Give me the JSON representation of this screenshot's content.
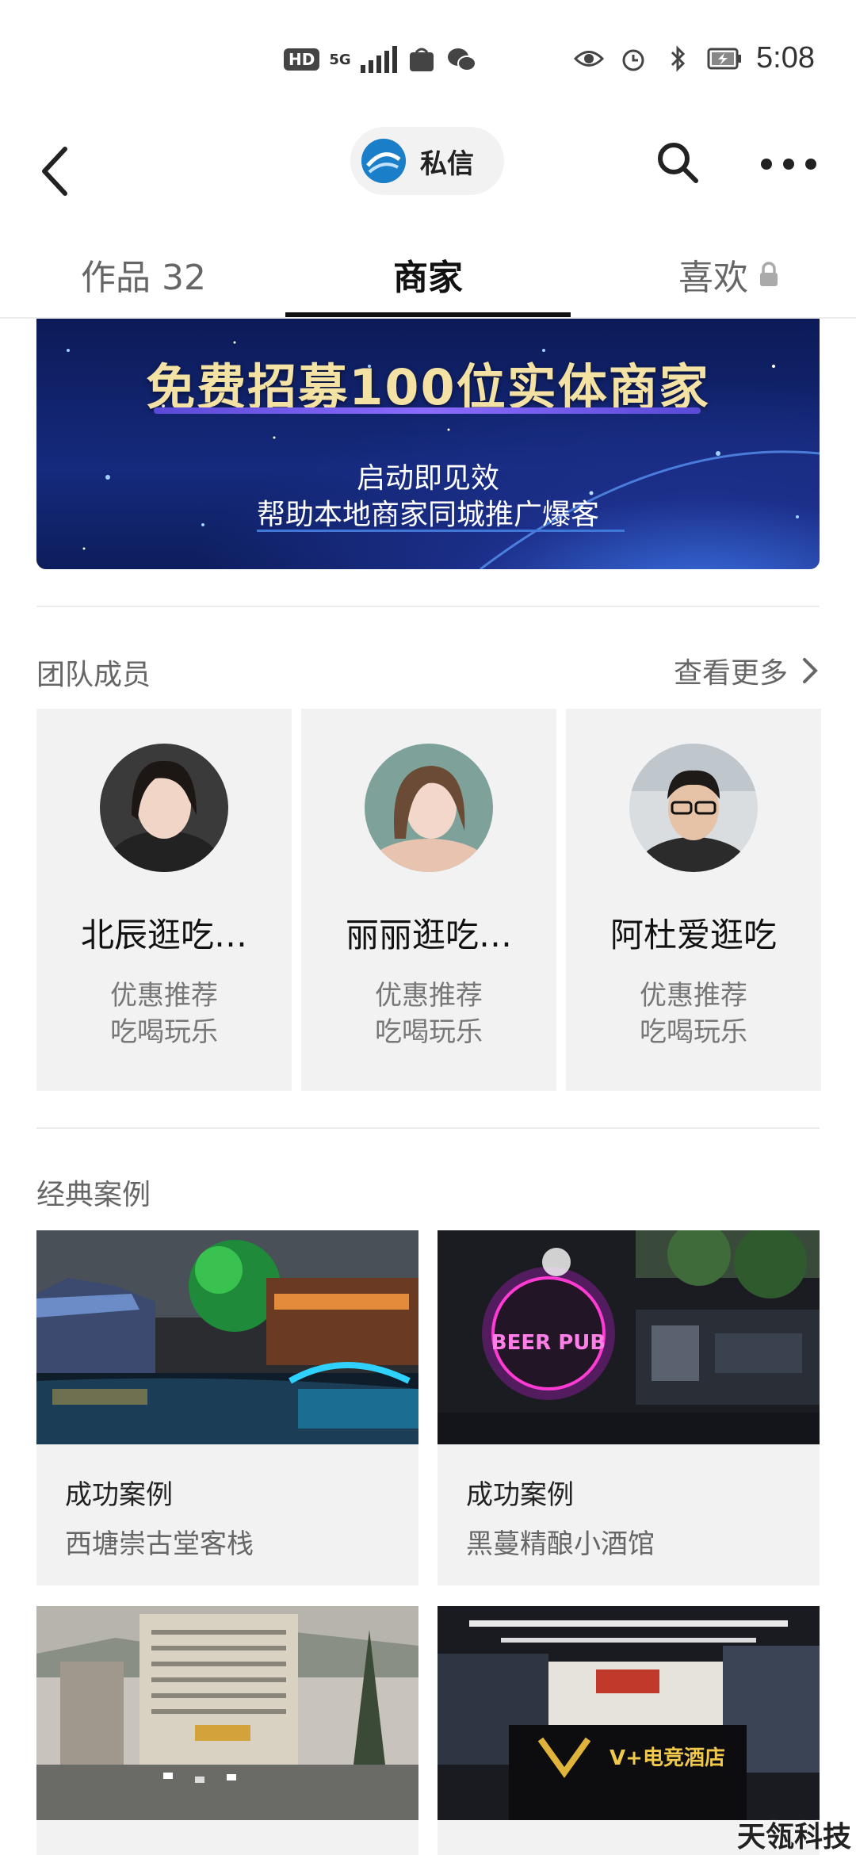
{
  "status_bar": {
    "hd": "HD",
    "network": "5G",
    "time": "5:08"
  },
  "header": {
    "message_label": "私信"
  },
  "tabs": [
    {
      "label": "作品 32"
    },
    {
      "label": "商家"
    },
    {
      "label": "喜欢"
    }
  ],
  "banner": {
    "title": "免费招募100位实体商家",
    "line1": "启动即见效",
    "line2": "帮助本地商家同城推广爆客"
  },
  "team": {
    "title": "团队成员",
    "see_more": "查看更多",
    "members": [
      {
        "name": "北辰逛吃…",
        "tag1": "优惠推荐",
        "tag2": "吃喝玩乐"
      },
      {
        "name": "丽丽逛吃…",
        "tag1": "优惠推荐",
        "tag2": "吃喝玩乐"
      },
      {
        "name": "阿杜爱逛吃",
        "tag1": "优惠推荐",
        "tag2": "吃喝玩乐"
      }
    ]
  },
  "cases": {
    "title": "经典案例",
    "items": [
      {
        "label": "成功案例",
        "name": "西塘崇古堂客栈"
      },
      {
        "label": "成功案例",
        "name": "黑蔓精酿小酒馆",
        "sign_text": "BEER PUB"
      },
      {
        "label": "",
        "name": ""
      },
      {
        "label": "",
        "name": "",
        "sign_text": "V+电竞酒店"
      }
    ]
  },
  "watermark": "天瓴科技",
  "colors": {
    "accent": "#111111",
    "card_bg": "#f2f2f2",
    "banner_title": "#f3e2a3"
  }
}
